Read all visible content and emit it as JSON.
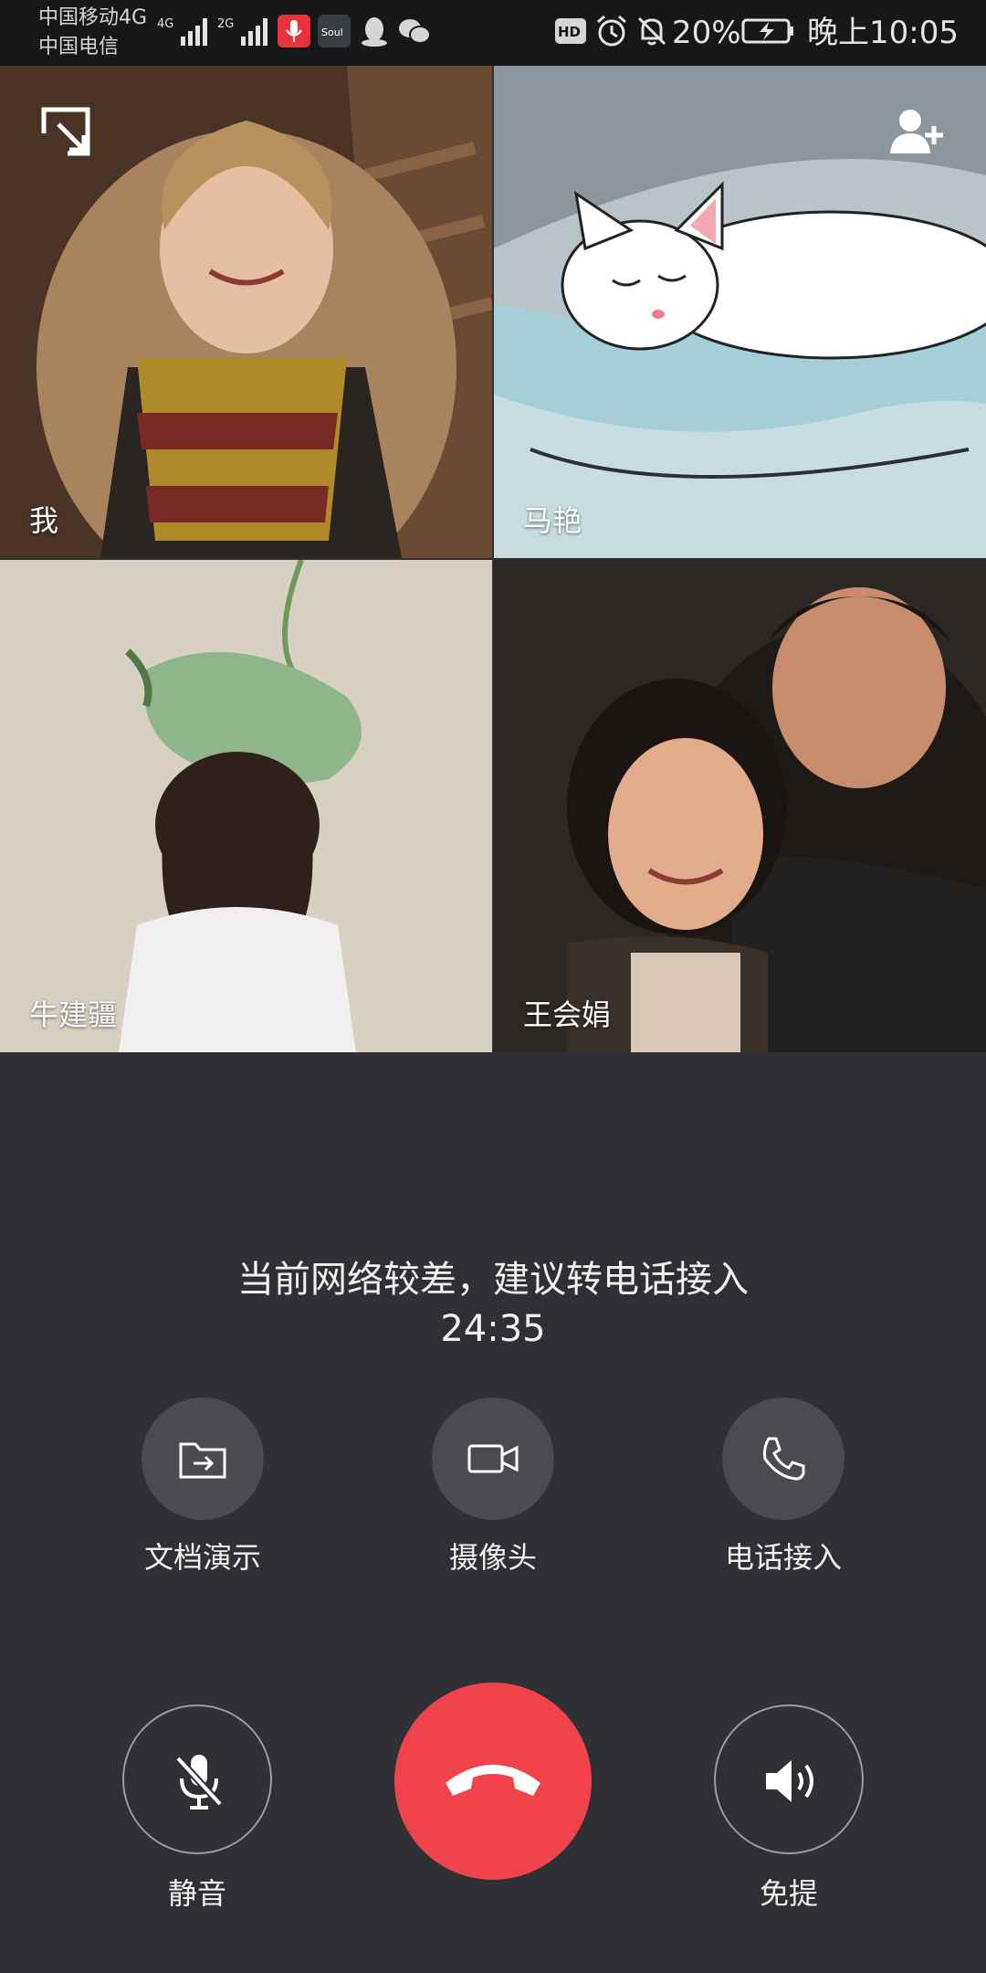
{
  "status_bar": {
    "carrier_1": "中国移动4G",
    "carrier_2": "中国电信",
    "net_1": "4G",
    "net_2": "2G",
    "hd": "HD",
    "battery": "20%",
    "time": "晚上10:05"
  },
  "participants": [
    {
      "name": "我"
    },
    {
      "name": "马艳"
    },
    {
      "name": "牛建疆"
    },
    {
      "name": "王会娟"
    }
  ],
  "call": {
    "network_hint": "当前网络较差，建议转电话接入",
    "duration": "24:35"
  },
  "features": {
    "share_doc": "文档演示",
    "camera": "摄像头",
    "phone_join": "电话接入"
  },
  "controls": {
    "mute": "静音",
    "speaker": "免提"
  },
  "colors": {
    "background": "#2e3034",
    "hangup": "#f0434b",
    "feature_button": "#494b4f"
  }
}
